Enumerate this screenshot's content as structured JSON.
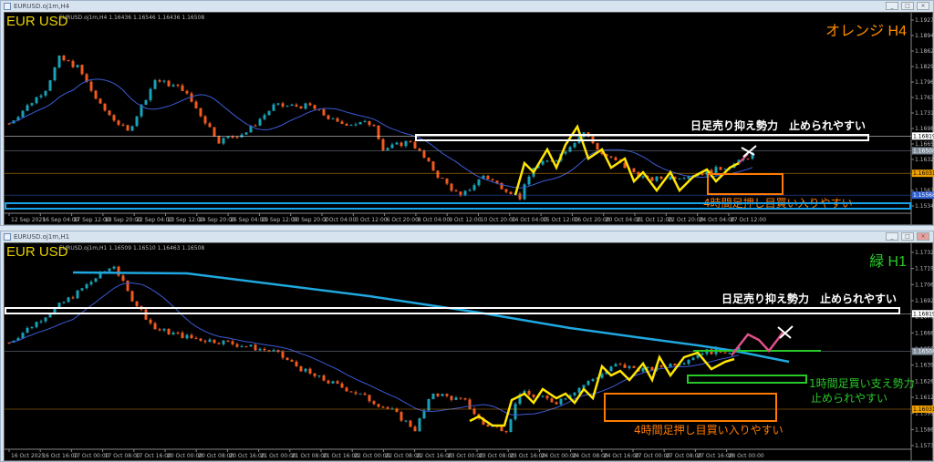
{
  "colors": {
    "bull": "#17a2b8",
    "bear": "#f05a1e",
    "ma": "#3b5bd6",
    "ma_long": "#1fa8e0",
    "zigzag": "#ffe600",
    "forecast": "#e0508a",
    "orange": "#ff7a00",
    "green": "#28c828",
    "white": "#ffffff",
    "blue_line": "#1aa0e6",
    "symbol": "#e8d000"
  },
  "top": {
    "window_title": "EURUSD.oj1m,H4",
    "ohlc": "EURUSD.oj1m,H4  1.16436 1.16546 1.16436 1.16508",
    "symbol": "EUR USD",
    "timeframe_label": "オレンジ H4",
    "note_daily": "日足売り抑え勢力　止められやすい",
    "note_h4": "4時間足押し目買い入りやすい",
    "price_ticks": [
      "1.19275",
      "1.18945",
      "1.18620",
      "1.18290",
      "1.17965",
      "1.17635",
      "1.17310",
      "1.16980",
      "1.16655",
      "1.16325",
      "1.16000",
      "1.15670",
      "1.15340"
    ],
    "price_range": [
      1.1534,
      1.19275
    ],
    "markers": [
      {
        "price": "1.16819",
        "color": "#ffffff",
        "text": "#000"
      },
      {
        "price": "1.16508",
        "color": "#7f8c99",
        "text": "#fff"
      },
      {
        "price": "1.16031",
        "color": "#f0a000",
        "text": "#000"
      },
      {
        "price": "1.15568",
        "color": "#3060d0",
        "text": "#fff"
      }
    ],
    "time_labels": [
      "12 Sep 2025",
      "16 Sep 04:00",
      "17 Sep 12:00",
      "18 Sep 20:00",
      "22 Sep 04:00",
      "23 Sep 12:00",
      "24 Sep 20:00",
      "26 Sep 04:00",
      "29 Sep 12:00",
      "30 Sep 20:00",
      "2 Oct 04:00",
      "3 Oct 12:00",
      "6 Oct 20:00",
      "8 Oct 04:00",
      "9 Oct 12:00",
      "10 Oct 20:00",
      "14 Oct 04:00",
      "15 Oct 12:00",
      "16 Oct 20:00",
      "20 Oct 04:00",
      "21 Oct 12:00",
      "22 Oct 20:00",
      "24 Oct 04:00",
      "27 Oct 12:00"
    ],
    "price_path": [
      [
        0,
        1.17087
      ],
      [
        8,
        1.17822
      ],
      [
        11,
        1.18466
      ],
      [
        15,
        1.18282
      ],
      [
        20,
        1.17454
      ],
      [
        26,
        1.16903
      ],
      [
        32,
        1.18006
      ],
      [
        38,
        1.17822
      ],
      [
        46,
        1.16719
      ],
      [
        52,
        1.16903
      ],
      [
        58,
        1.17454
      ],
      [
        66,
        1.17454
      ],
      [
        72,
        1.17087
      ],
      [
        80,
        1.17087
      ],
      [
        82,
        1.16535
      ],
      [
        88,
        1.16719
      ],
      [
        94,
        1.15983
      ],
      [
        99,
        1.15523
      ],
      [
        104,
        1.15983
      ],
      [
        112,
        1.15523
      ],
      [
        115,
        1.16167
      ],
      [
        120,
        1.16351
      ],
      [
        126,
        1.16903
      ],
      [
        130,
        1.16443
      ],
      [
        140,
        1.15891
      ],
      [
        148,
        1.15983
      ],
      [
        154,
        1.16075
      ],
      [
        160,
        1.16259
      ],
      [
        163,
        1.16443
      ]
    ]
  },
  "bottom": {
    "window_title": "EURUSD.oj1m,H1",
    "ohlc": "EURUSD.oj1m,H1  1.16509 1.16510 1.16463 1.16508",
    "symbol": "EUR USD",
    "timeframe_label": "緑 H1",
    "note_daily": "日足売り抑え勢力　止められやすい",
    "note_h1_line1": "1時間足買い支え勢力",
    "note_h1_line2": "止められやすい",
    "note_h4": "4時間足押し目買い入りやすい",
    "price_ticks": [
      "1.17325",
      "1.17195",
      "1.17060",
      "1.16925",
      "1.16790",
      "1.16660",
      "1.16530",
      "1.16395",
      "1.16260",
      "1.16125",
      "1.15995",
      "1.15860",
      "1.15730"
    ],
    "price_range": [
      1.1573,
      1.17325
    ],
    "markers": [
      {
        "price": "1.16819",
        "color": "#ffffff",
        "text": "#000"
      },
      {
        "price": "1.16508",
        "color": "#7f8c99",
        "text": "#fff"
      },
      {
        "price": "1.16031",
        "color": "#f0a000",
        "text": "#000"
      }
    ],
    "time_labels": [
      "16 Oct 2025",
      "16 Oct 16:00",
      "17 Oct 00:00",
      "17 Oct 08:00",
      "17 Oct 16:00",
      "20 Oct 00:00",
      "20 Oct 08:00",
      "20 Oct 16:00",
      "21 Oct 00:00",
      "21 Oct 08:00",
      "21 Oct 16:00",
      "22 Oct 00:00",
      "22 Oct 08:00",
      "22 Oct 16:00",
      "23 Oct 00:00",
      "23 Oct 08:00",
      "23 Oct 16:00",
      "24 Oct 00:00",
      "24 Oct 08:00",
      "24 Oct 16:00",
      "27 Oct 00:00",
      "27 Oct 08:00",
      "27 Oct 16:00",
      "28 Oct 00:00"
    ],
    "price_path": [
      [
        0,
        1.16581
      ],
      [
        8,
        1.16806
      ],
      [
        15,
        1.16994
      ],
      [
        20,
        1.17145
      ],
      [
        23,
        1.1722
      ],
      [
        26,
        1.16994
      ],
      [
        32,
        1.16693
      ],
      [
        40,
        1.16618
      ],
      [
        48,
        1.16581
      ],
      [
        58,
        1.16505
      ],
      [
        66,
        1.16317
      ],
      [
        76,
        1.16167
      ],
      [
        84,
        1.16016
      ],
      [
        89,
        1.15866
      ],
      [
        93,
        1.16167
      ],
      [
        100,
        1.16092
      ],
      [
        104,
        1.15904
      ],
      [
        109,
        1.15866
      ],
      [
        112,
        1.16167
      ],
      [
        120,
        1.16092
      ],
      [
        128,
        1.1628
      ],
      [
        133,
        1.16392
      ],
      [
        140,
        1.16355
      ],
      [
        148,
        1.1643
      ],
      [
        152,
        1.16505
      ],
      [
        160,
        1.1652
      ]
    ]
  }
}
